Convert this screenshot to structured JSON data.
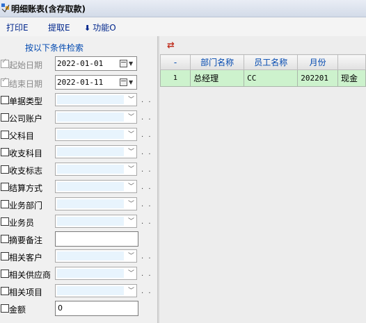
{
  "window": {
    "title": "明细账表(含存取款)"
  },
  "toolbar": {
    "print_label": "打印E",
    "fetch_label": "提取E",
    "function_label": "功能O"
  },
  "conditions": {
    "title": "按以下条件检索",
    "start_date": {
      "label": "起始日期",
      "value": "2022-01-01",
      "checked": true
    },
    "end_date": {
      "label": "结束日期",
      "value": "2022-01-11",
      "checked": true
    },
    "doc_type": {
      "label": "单据类型",
      "value": ""
    },
    "company_account": {
      "label": "公司账户",
      "value": ""
    },
    "parent_subject": {
      "label": "父科目",
      "value": ""
    },
    "income_expense_subject": {
      "label": "收支科目",
      "value": ""
    },
    "income_expense_flag": {
      "label": "收支标志",
      "value": ""
    },
    "settlement_method": {
      "label": "结算方式",
      "value": ""
    },
    "business_dept": {
      "label": "业务部门",
      "value": ""
    },
    "salesperson": {
      "label": "业务员",
      "value": ""
    },
    "summary_note": {
      "label": "摘要备注",
      "value": ""
    },
    "related_customer": {
      "label": "相关客户",
      "value": ""
    },
    "related_supplier": {
      "label": "相关供应商",
      "value": ""
    },
    "related_project": {
      "label": "相关项目",
      "value": ""
    },
    "amount": {
      "label": "金额",
      "value": "0"
    },
    "dots": ". ."
  },
  "grid": {
    "swap_icon": "⇄",
    "columns": [
      "-",
      "部门名称",
      "员工名称",
      "月份",
      ""
    ],
    "rows": [
      {
        "no": "1",
        "dept": "总经理",
        "employee": "CC",
        "month": "202201",
        "type": "现金"
      }
    ]
  }
}
